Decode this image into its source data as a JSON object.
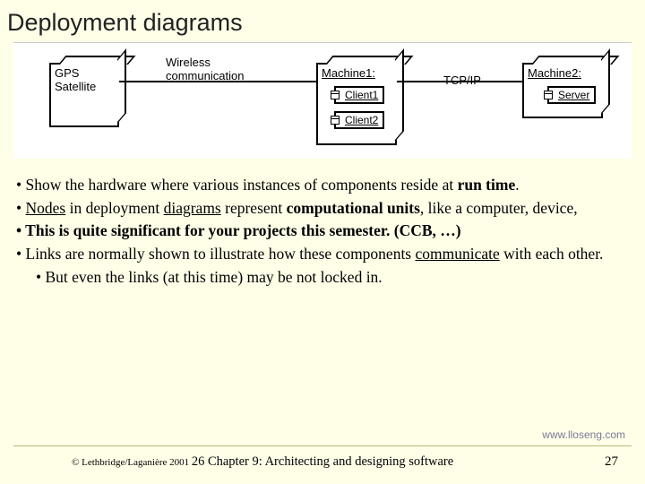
{
  "title": "Deployment diagrams",
  "diagram": {
    "gps": "GPS\nSatellite",
    "link1": "Wireless\ncommunication",
    "machine1": "Machine1:",
    "client1": "Client1",
    "client2": "Client2",
    "link2": "TCP/IP",
    "machine2": "Machine2:",
    "server": "Server"
  },
  "bullets": {
    "b1a": "• Show the hardware where various instances of components reside at ",
    "b1b": "run time",
    "b1c": ".",
    "b2a": "• ",
    "b2b": "Nodes",
    "b2c": " in deployment ",
    "b2d": "diagrams",
    "b2e": " represent ",
    "b2f": "computational units",
    "b2g": ", like a computer, device,",
    "b3a": "•  This is quite significant for your projects this semester.  (CCB, …)",
    "b4a": "• Links are normally shown to illustrate how these components ",
    "b4b": "communicate",
    "b4c": " with each other.",
    "b5": "• But even the links (at this time) may be not locked in."
  },
  "footer": {
    "url": "www.lloseng.com",
    "copy": "© Lethbridge/Laganière 2001",
    "center": "26 Chapter 9: Architecting and designing software",
    "page": "27"
  }
}
